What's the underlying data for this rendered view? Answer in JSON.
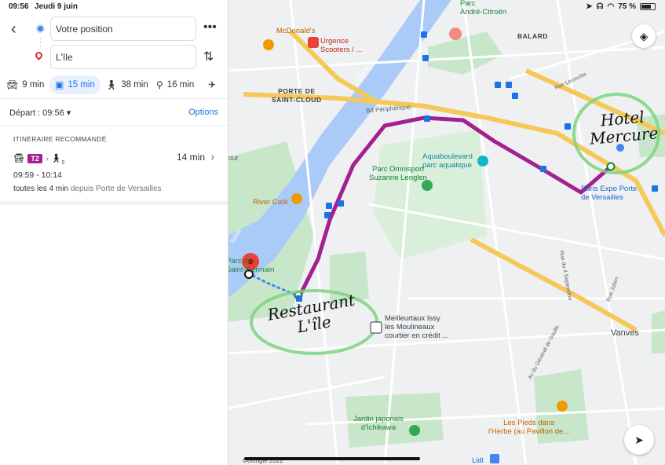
{
  "status": {
    "time": "09:56",
    "date": "Jeudi 9 juin",
    "battery": "75 %",
    "battery_level": 0.75
  },
  "search": {
    "origin": "Votre position",
    "destination": "L'île"
  },
  "modes": [
    {
      "icon": "car-icon",
      "label": "9 min"
    },
    {
      "icon": "transit-icon",
      "label": "15 min"
    },
    {
      "icon": "walk-icon",
      "label": "38 min"
    },
    {
      "icon": "bike-icon",
      "label": "16 min"
    }
  ],
  "depart": "Départ : 09:56",
  "options": "Options",
  "recommended": "ITINÉRAIRE RECOMMANDÉ",
  "route": {
    "line": "T2",
    "walk_sub": "5",
    "duration": "14 min",
    "times": "09:59 - 10:14",
    "freq_main": "toutes les 4 min",
    "freq_from": "depuis Porte de Versailles"
  },
  "map": {
    "labels": {
      "mcdonalds": "McDonald's",
      "urgence": "Urgence\nScooters / ...",
      "parc_andre": "Parc\nAndré-Citroën",
      "balard": "BALARD",
      "rue_lecourbe": "Rue Lecourbe",
      "porte_st_cloud": "PORTE DE\nSAINT-CLOUD",
      "bd_peripherique": "Bd Périphérique",
      "seine": "Seine",
      "aquaboulevard": "Aquaboulevard\nparc aquatique",
      "parc_omnisport": "Parc Omnisport\nSuzanne Lenglen",
      "paris_expo": "Paris Expo Porte\nde Versailles",
      "river_cafe": "River Café",
      "parc_st_germain": "Parc de\nSaint-Germain",
      "meilleurtaux": "Meilleurtaux Issy\nles Moulineaux\ncourtier en crédit ...",
      "vanves": "Vanves",
      "rue_4sept": "Rue du 4 Septembre",
      "av_gaulle": "Av du Général de Gaulle",
      "rue_julien": "Rue Julien",
      "jardin": "Jardin japonais\nd'Ichikawa",
      "pieds": "Les Pieds dans\nl'Herbe (au Pavillon de...",
      "lidl": "Lidl",
      "copyright": "©Google 2022",
      "cour": "our"
    },
    "annotations": {
      "restaurant": "Restaurant\nL'île",
      "hotel": "Hotel\nMercure"
    },
    "colors": {
      "route": "#a3208e",
      "water": "#aacbf8",
      "park": "#c8e6c9",
      "highway": "#f6c859",
      "annotation_circle": "#7ed37e"
    }
  }
}
